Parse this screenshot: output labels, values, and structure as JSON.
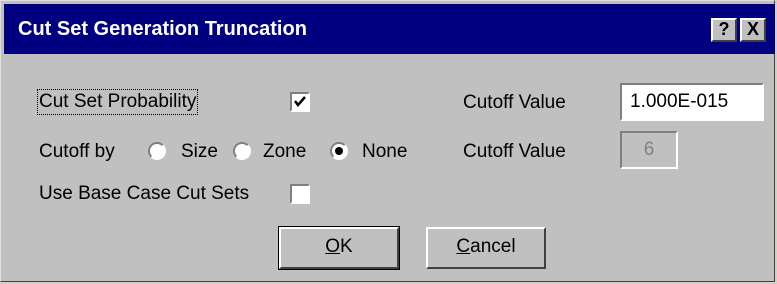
{
  "dialog": {
    "title": "Cut Set Generation Truncation",
    "help_button": "?",
    "close_button": "X"
  },
  "probability": {
    "label": "Cut Set Probability",
    "checked": true,
    "cutoff_label": "Cutoff Value",
    "cutoff_value": "1.000E-015"
  },
  "cutoff_by": {
    "label": "Cutoff by",
    "options": [
      "Size",
      "Zone",
      "None"
    ],
    "selected": "None",
    "cutoff_label": "Cutoff Value",
    "cutoff_value": "6"
  },
  "base_case": {
    "label": "Use Base Case Cut Sets",
    "checked": false
  },
  "buttons": {
    "ok_accel": "O",
    "ok_rest": "K",
    "cancel_accel": "C",
    "cancel_rest": "ancel"
  },
  "colors": {
    "titlebar": "#000080",
    "face": "#c0c0c0"
  }
}
